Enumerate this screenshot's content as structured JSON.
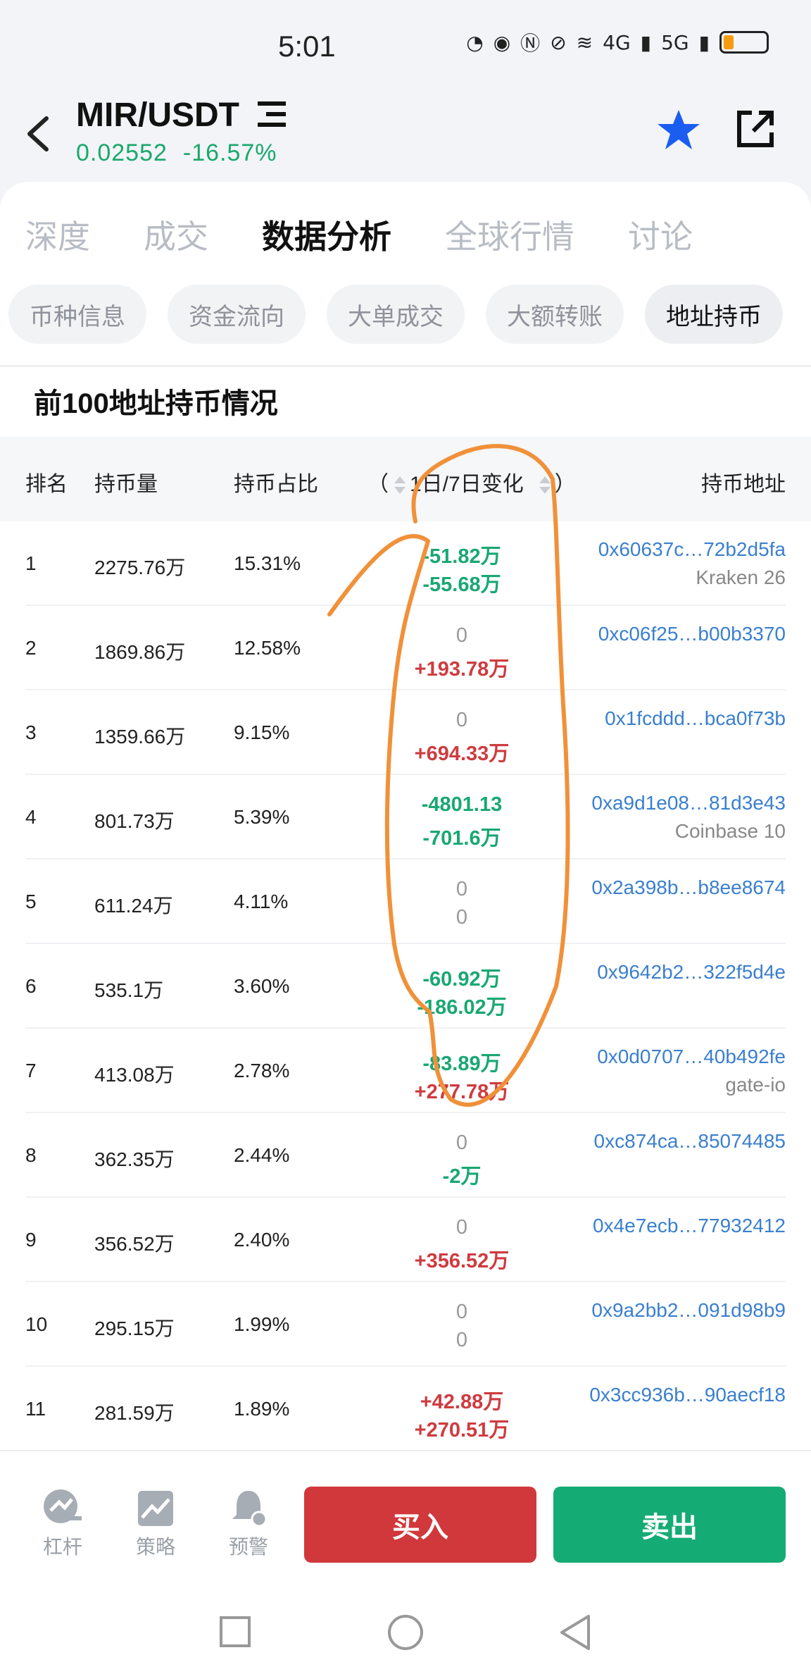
{
  "status": {
    "time": "5:01",
    "net1": "4G",
    "net2": "5G"
  },
  "header": {
    "pair": "MIR/USDT",
    "price": "0.02552",
    "change": "-16.57%"
  },
  "tabs": [
    {
      "label": "深度"
    },
    {
      "label": "成交"
    },
    {
      "label": "数据分析"
    },
    {
      "label": "全球行情"
    },
    {
      "label": "讨论"
    }
  ],
  "subtabs": [
    {
      "label": "币种信息"
    },
    {
      "label": "资金流向"
    },
    {
      "label": "大单成交"
    },
    {
      "label": "大额转账"
    },
    {
      "label": "地址持币"
    }
  ],
  "section_title": "前100地址持币情况",
  "table": {
    "headers": {
      "rank": "排名",
      "qty": "持币量",
      "pct": "持币占比",
      "change_open": "（",
      "change": "1日/7日变化",
      "change_close": "）",
      "addr": "持币地址"
    },
    "rows": [
      {
        "rank": "1",
        "qty": "2275.76万",
        "pct": "15.31%",
        "ch1": "-51.82万",
        "ch2": "-55.68万",
        "addr": "0x60637c…72b2d5fa",
        "label": "Kraken 26"
      },
      {
        "rank": "2",
        "qty": "1869.86万",
        "pct": "12.58%",
        "ch1": "0",
        "ch2": "+193.78万",
        "addr": "0xc06f25…b00b3370",
        "label": ""
      },
      {
        "rank": "3",
        "qty": "1359.66万",
        "pct": "9.15%",
        "ch1": "0",
        "ch2": "+694.33万",
        "addr": "0x1fcddd…bca0f73b",
        "label": ""
      },
      {
        "rank": "4",
        "qty": "801.73万",
        "pct": "5.39%",
        "ch1": "-4801.13",
        "ch2": "-701.6万",
        "addr": "0xa9d1e08…81d3e43",
        "label": "Coinbase 10"
      },
      {
        "rank": "5",
        "qty": "611.24万",
        "pct": "4.11%",
        "ch1": "0",
        "ch2": "0",
        "addr": "0x2a398b…b8ee8674",
        "label": ""
      },
      {
        "rank": "6",
        "qty": "535.1万",
        "pct": "3.60%",
        "ch1": "-60.92万",
        "ch2": "-186.02万",
        "addr": "0x9642b2…322f5d4e",
        "label": ""
      },
      {
        "rank": "7",
        "qty": "413.08万",
        "pct": "2.78%",
        "ch1": "-83.89万",
        "ch2": "+277.78万",
        "addr": "0x0d0707…40b492fe",
        "label": "gate-io"
      },
      {
        "rank": "8",
        "qty": "362.35万",
        "pct": "2.44%",
        "ch1": "0",
        "ch2": "-2万",
        "addr": "0xc874ca…85074485",
        "label": ""
      },
      {
        "rank": "9",
        "qty": "356.52万",
        "pct": "2.40%",
        "ch1": "0",
        "ch2": "+356.52万",
        "addr": "0x4e7ecb…77932412",
        "label": ""
      },
      {
        "rank": "10",
        "qty": "295.15万",
        "pct": "1.99%",
        "ch1": "0",
        "ch2": "0",
        "addr": "0x9a2bb2…091d98b9",
        "label": ""
      },
      {
        "rank": "11",
        "qty": "281.59万",
        "pct": "1.89%",
        "ch1": "+42.88万",
        "ch2": "+270.51万",
        "addr": "0x3cc936b…90aecf18",
        "label": ""
      }
    ]
  },
  "bottom": {
    "leverage": "杠杆",
    "strategy": "策略",
    "alert": "预警",
    "buy": "买入",
    "sell": "卖出"
  },
  "colors": {
    "up": "#15ab74",
    "down": "#d0383c",
    "link": "#3a7fcf",
    "annotation": "#f0913a"
  }
}
